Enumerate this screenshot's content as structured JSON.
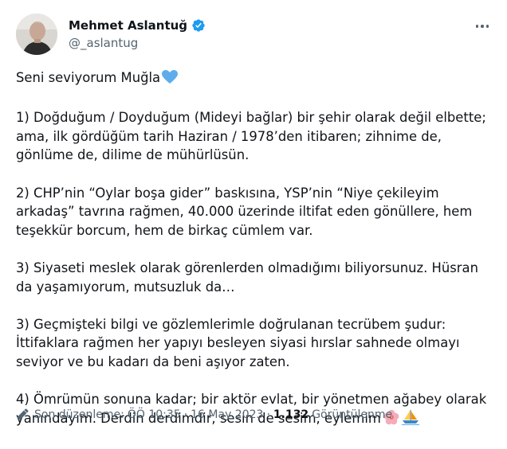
{
  "author": {
    "display_name": "Mehmet Aslantuğ",
    "handle": "@_aslantug",
    "verified": true,
    "verified_color": "#1d9bf0"
  },
  "icons": {
    "more": "more-horizontal-icon",
    "verified": "verified-badge-icon",
    "edit": "pencil-icon",
    "heart": "blue-heart-emoji",
    "flower": "hibiscus-emoji",
    "boat": "sailboat-emoji"
  },
  "tweet": {
    "intro": "Seni seviyorum Muğla",
    "paragraphs": [
      "1) Doğduğum / Doyduğum (Mideyi bağlar) bir şehir olarak değil elbette; ama, ilk gördüğüm tarih Haziran / 1978’den itibaren; zihnime de, gönlüme de, dilime de mühürlüsün.",
      "2) CHP’nin “Oylar boşa gider” baskısına, YSP’nin “Niye çekileyim arkadaş” tavrına rağmen, 40.000 üzerinde iltifat eden gönüllere, hem teşekkür borcum, hem de birkaç cümlem var.",
      "3) Siyaseti meslek olarak görenlerden olmadığımı biliyorsunuz. Hüsran da yaşamıyorum, mutsuzluk da…",
      "3) Geçmişteki bilgi ve gözlemlerimle doğrulanan tecrübem şudur: İttifaklara rağmen her yapıyı besleyen siyasi hırslar sahnede olmayı seviyor ve bu kadarı da beni aşıyor zaten.",
      "4) Ömrümün sonuna kadar; bir aktör evlat, bir yönetmen ağabey olarak yanındayım. Derdin derdimdir, sesin de sesim, eylemim"
    ]
  },
  "meta": {
    "edit_label": "Son düzenleme:",
    "time": "ÖÖ 10:35",
    "date": "16 May 2023",
    "separator": "·",
    "views_count": "1.132",
    "views_label": "Görüntülenme"
  }
}
